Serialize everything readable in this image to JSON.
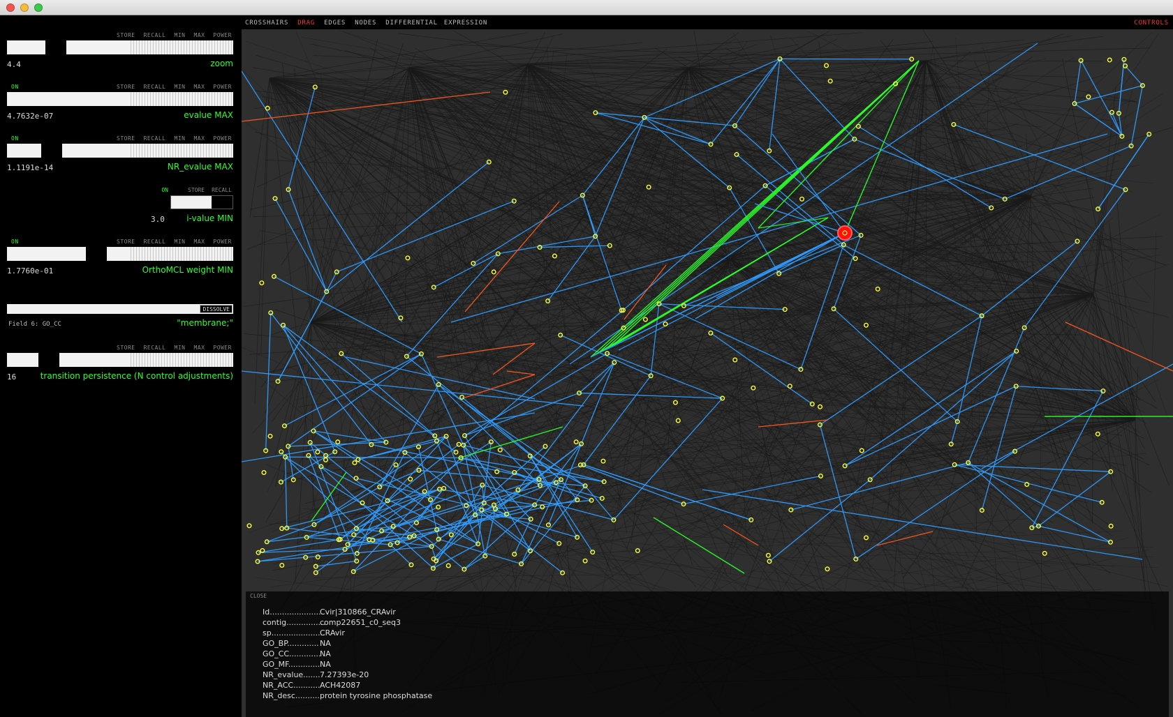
{
  "controls_header": {
    "store": "STORE",
    "recall": "RECALL",
    "min": "MIN",
    "max": "MAX",
    "power": "POWER",
    "on": "ON"
  },
  "panel": {
    "zoom": {
      "value": "4.4",
      "label": "zoom",
      "level": 0.17
    },
    "evalue_max": {
      "value": "4.7632e-07",
      "label": "evalue MAX",
      "level": 0.66
    },
    "nr_evalue_max": {
      "value": "1.1191e-14",
      "label": "NR_evalue MAX",
      "level": 0.15
    },
    "i_value_min": {
      "value": "3.0",
      "label": "i-value MIN"
    },
    "orthomcl_weight_min": {
      "value": "1.7760e-01",
      "label": "OrthoMCL weight MIN",
      "level": 0.35
    },
    "dissolve": {
      "button": "DISSOLVE",
      "field": "Field 6: GO_CC",
      "value": "\"membrane;\""
    },
    "transition": {
      "value": "16",
      "label": "transition persistence (N control adjustments)",
      "level": 0.14
    }
  },
  "topbar": {
    "modes": [
      "CROSSHAIRS",
      "DRAG",
      "EDGES",
      "NODES",
      "DIFFERENTIAL",
      "EXPRESSION"
    ],
    "active_mode": "DRAG",
    "controls": "CONTROLS"
  },
  "colors": {
    "background": "#2f2f2f",
    "edge_gray": "#1a1a1a",
    "edge_blue": "#2f9cff",
    "edge_green": "#2cff2c",
    "edge_orange": "#ff5a20",
    "node": "#ffff33",
    "selected": "#ff1010",
    "label_green": "#2cff2c"
  },
  "info": {
    "close": "CLOSE",
    "rows": [
      {
        "key": "Id......................",
        "value": "Cvir|310866_CRAvir"
      },
      {
        "key": "contig................",
        "value": "comp22651_c0_seq3"
      },
      {
        "key": "sp......................",
        "value": "CRAvir"
      },
      {
        "key": "GO_BP.............",
        "value": "NA"
      },
      {
        "key": "GO_CC.............",
        "value": "NA"
      },
      {
        "key": "GO_MF.............",
        "value": "NA"
      },
      {
        "key": "NR_evalue.......",
        "value": "7.27393e-20"
      },
      {
        "key": "NR_ACC...........",
        "value": "ACH42087"
      },
      {
        "key": "NR_desc..........",
        "value": "protein tyrosine phosphatase"
      }
    ]
  }
}
